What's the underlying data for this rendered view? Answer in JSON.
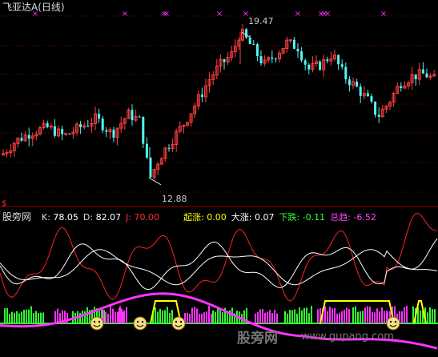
{
  "main": {
    "title": "飞亚达A",
    "period": "(日线)",
    "high_label": "19.47",
    "low_label": "12.88",
    "marker": "$"
  },
  "indicator": {
    "name": "股旁网",
    "readouts": [
      {
        "label": "K:",
        "value": "78.05",
        "color": "#ffffff"
      },
      {
        "label": "D:",
        "value": "82.07",
        "color": "#ffffff"
      },
      {
        "label": "J:",
        "value": "70.00",
        "color": "#ff3030"
      },
      {
        "label": "起涨:",
        "value": "0.00",
        "color": "#ffff00"
      },
      {
        "label": "大涨:",
        "value": "0.07",
        "color": "#ffffff"
      },
      {
        "label": "下跌:",
        "value": "-0.11",
        "color": "#33ff33"
      },
      {
        "label": "总趋:",
        "value": "-6.52",
        "color": "#ff44ff"
      }
    ]
  },
  "watermark": {
    "cn": "股旁网",
    "url": "www.gupang.com"
  },
  "colors": {
    "up": "#ff4040",
    "down": "#54f4f4",
    "k_line": "#ffffff",
    "d_line": "#ffffff",
    "j_line": "#ff2020",
    "trend": "#ff33ff",
    "green_bar": "#33ff33",
    "magenta_bar": "#ff33ff",
    "yellow": "#ffff00",
    "baseline": "#33ff33",
    "grid": "#8b0000"
  },
  "chart_data": {
    "type": "candlestick",
    "price_high": 19.47,
    "price_low": 12.88,
    "price_range": [
      12.3,
      20.2
    ],
    "kdj_current": {
      "K": 78.05,
      "D": 82.07,
      "J": 70.0
    },
    "signals_current": {
      "起涨": 0.0,
      "大涨": 0.07,
      "下跌": -0.11,
      "总趋": -6.52
    }
  }
}
